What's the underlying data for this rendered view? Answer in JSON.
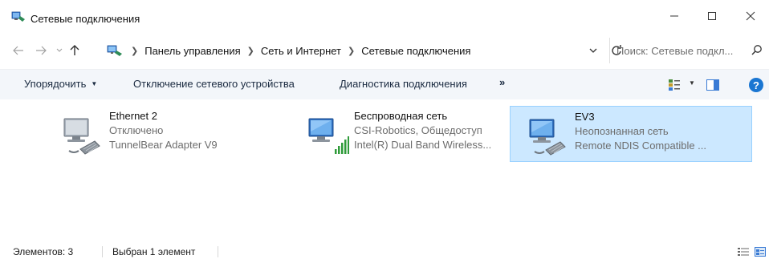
{
  "window": {
    "title": "Сетевые подключения",
    "icon": "network-connections-icon"
  },
  "address": {
    "breadcrumb": [
      "Панель управления",
      "Сеть и Интернет",
      "Сетевые подключения"
    ],
    "search_placeholder": "Поиск: Сетевые подкл..."
  },
  "commands": {
    "organize": "Упорядочить",
    "disable": "Отключение сетевого устройства",
    "diagnose": "Диагностика подключения",
    "more": "»",
    "help": "?"
  },
  "connections": [
    {
      "name": "Ethernet 2",
      "status": "Отключено",
      "device": "TunnelBear Adapter V9",
      "type": "wired",
      "selected": false
    },
    {
      "name": "Беспроводная сеть",
      "status": "CSI-Robotics, Общедоступ",
      "device": "Intel(R) Dual Band Wireless...",
      "type": "wireless",
      "selected": false
    },
    {
      "name": "EV3",
      "status": "Неопознанная сеть",
      "device": "Remote NDIS Compatible ...",
      "type": "wired",
      "selected": true
    }
  ],
  "statusbar": {
    "count": "Элементов: 3",
    "selected": "Выбран 1 элемент"
  },
  "colors": {
    "selection_bg": "#cce8ff",
    "selection_border": "#99d1ff",
    "commandbar_bg": "#f3f6fa",
    "help": "#1a76d2"
  }
}
